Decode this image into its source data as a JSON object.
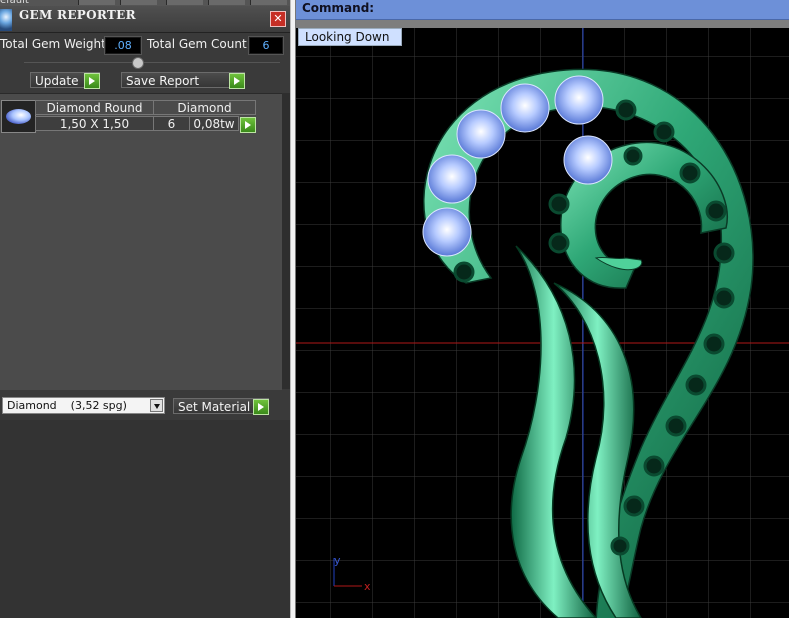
{
  "panel": {
    "window_label": "efault",
    "title": "GEM REPORTER",
    "close_label": "✕",
    "total_weight_label": "Total Gem Weight",
    "total_weight_value": ".08",
    "total_count_label": "Total Gem Count",
    "total_count_value": "6",
    "update_label": "Update",
    "save_report_label": "Save Report"
  },
  "table": {
    "headers": [
      "Diamond Round",
      "Diamond"
    ],
    "rows": [
      {
        "size": "1,50 X 1,50",
        "count": "6",
        "weight": "0,08tw"
      }
    ]
  },
  "material": {
    "selected": "Diamond    (3,52 spg)",
    "set_label": "Set Material"
  },
  "viewport": {
    "command_label": "Command:",
    "view_name": "Looking Down",
    "axis_y": "y",
    "axis_x": "x"
  },
  "colors": {
    "metal": "#2fa877",
    "metal_light": "#7fe6b8",
    "metal_dark": "#0d5a3a",
    "gem": "#a9c2ff",
    "grid": "#3a3a3a",
    "axis_red": "#b01818",
    "axis_blue": "#2040c0",
    "command_bar": "#6d90d8"
  }
}
